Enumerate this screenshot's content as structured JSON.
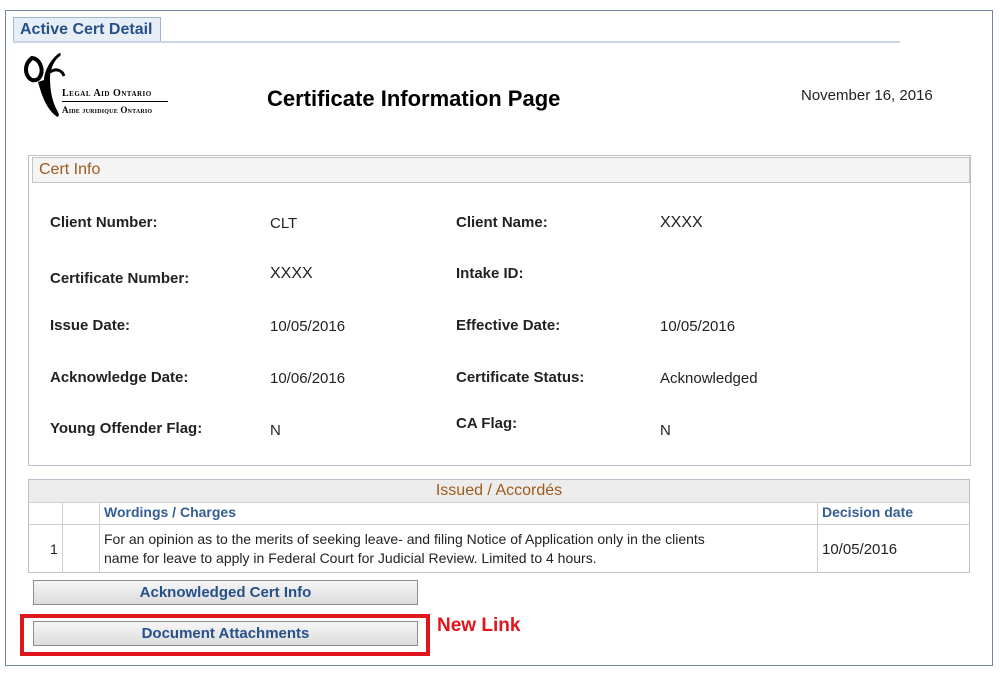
{
  "tab": {
    "label": "Active Cert Detail"
  },
  "logo": {
    "line1": "Legal Aid Ontario",
    "line2": "Aide juridique Ontario"
  },
  "header": {
    "title": "Certificate Information Page",
    "date": "November 16, 2016"
  },
  "cert_info": {
    "section_title": "Cert Info",
    "fields": [
      {
        "label": "Client Number:",
        "value": "CLT"
      },
      {
        "label": "Client Name:",
        "value": "XXXX"
      },
      {
        "label": "Certificate Number:",
        "value": "XXXX"
      },
      {
        "label": "Intake ID:",
        "value": ""
      },
      {
        "label": "Issue Date:",
        "value": "10/05/2016"
      },
      {
        "label": "Effective Date:",
        "value": "10/05/2016"
      },
      {
        "label": "Acknowledge Date:",
        "value": "10/06/2016"
      },
      {
        "label": "Certificate Status:",
        "value": "Acknowledged"
      },
      {
        "label": "Young Offender Flag:",
        "value": "N"
      },
      {
        "label": "CA Flag:",
        "value": "N"
      }
    ]
  },
  "issued": {
    "title": "Issued / Accordés",
    "columns": {
      "wordings": "Wordings / Charges",
      "decision": "Decision date"
    },
    "rows": [
      {
        "num": "1",
        "wording_line1": "For an opinion as to the merits of seeking leave- and filing Notice of Application only in the clients",
        "wording_line2": "name for leave to apply in Federal Court for Judicial Review.  Limited to 4 hours.",
        "decision_date": "10/05/2016"
      }
    ]
  },
  "buttons": {
    "ack": "Acknowledged Cert Info",
    "docs": "Document Attachments"
  },
  "annotation": {
    "callout": "New Link",
    "color": "#e1161c"
  }
}
